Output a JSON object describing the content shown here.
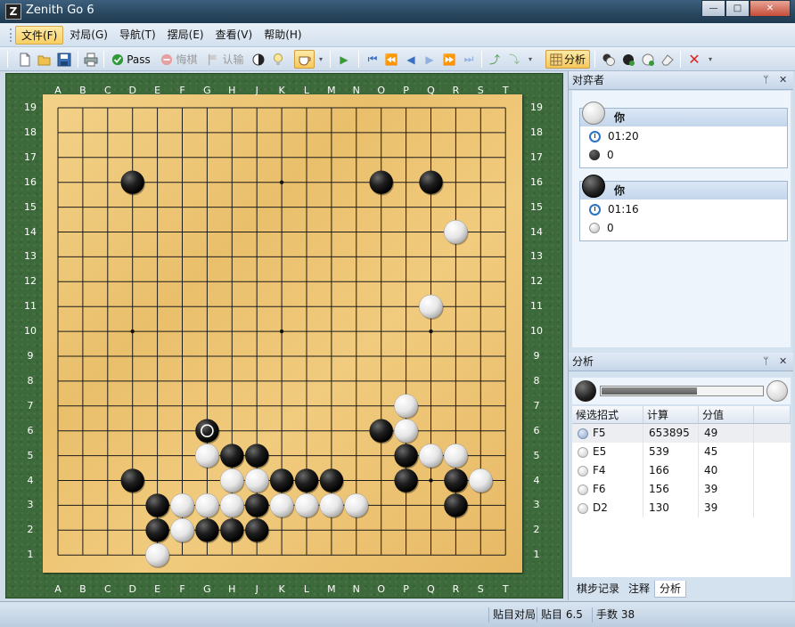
{
  "window": {
    "title": "Zenith Go 6",
    "min_label": "—",
    "max_label": "□",
    "close_label": "✕"
  },
  "menu": [
    {
      "label": "文件(F)",
      "active": true
    },
    {
      "label": "对局(G)"
    },
    {
      "label": "导航(T)"
    },
    {
      "label": "摆局(E)"
    },
    {
      "label": "查看(V)"
    },
    {
      "label": "帮助(H)"
    }
  ],
  "toolbar": {
    "pass_label": "Pass",
    "undo_label": "悔棋",
    "resign_label": "认输",
    "analysis_label": "分析"
  },
  "board": {
    "columns": [
      "A",
      "B",
      "C",
      "D",
      "E",
      "F",
      "G",
      "H",
      "J",
      "K",
      "L",
      "M",
      "N",
      "O",
      "P",
      "Q",
      "R",
      "S",
      "T"
    ],
    "rows": [
      "19",
      "18",
      "17",
      "16",
      "15",
      "14",
      "13",
      "12",
      "11",
      "10",
      "9",
      "8",
      "7",
      "6",
      "5",
      "4",
      "3",
      "2",
      "1"
    ],
    "star_points": [
      "D16",
      "K16",
      "Q16",
      "D10",
      "K10",
      "Q10",
      "D4",
      "K4",
      "Q4"
    ],
    "black_stones": [
      "D16",
      "O16",
      "Q16",
      "G6",
      "O6",
      "H5",
      "J5",
      "P5",
      "D4",
      "K4",
      "L4",
      "M4",
      "P4",
      "R4",
      "E3",
      "J3",
      "R3",
      "E2",
      "G2",
      "H2",
      "J2"
    ],
    "white_stones": [
      "R14",
      "Q11",
      "P7",
      "P6",
      "G5",
      "Q5",
      "R5",
      "H4",
      "J4",
      "S4",
      "F3",
      "G3",
      "H3",
      "K3",
      "L3",
      "M3",
      "N3",
      "F2",
      "E1"
    ],
    "last_move": "G6"
  },
  "players_panel": {
    "title": "对弈者",
    "pin_label": "ᛘ",
    "close_label": "✕",
    "white": {
      "name": "你",
      "time": "01:20",
      "captures": "0"
    },
    "black": {
      "name": "你",
      "time": "01:16",
      "captures": "0"
    }
  },
  "analysis_panel": {
    "title": "分析",
    "pin_label": "ᛘ",
    "close_label": "✕",
    "progress": 0.59,
    "headers": [
      "候选招式",
      "计算",
      "分值"
    ],
    "rows": [
      {
        "move": "F5",
        "count": "653895",
        "score": "49",
        "selected": true
      },
      {
        "move": "E5",
        "count": "539",
        "score": "45"
      },
      {
        "move": "F4",
        "count": "166",
        "score": "40"
      },
      {
        "move": "F6",
        "count": "156",
        "score": "39"
      },
      {
        "move": "D2",
        "count": "130",
        "score": "39"
      }
    ],
    "tabs": [
      {
        "label": "棋步记录"
      },
      {
        "label": "注释"
      },
      {
        "label": "分析",
        "active": true
      }
    ]
  },
  "status": {
    "mode": "贴目对局",
    "komi": "贴目 6.5",
    "moves": "手数 38"
  },
  "colors": {
    "board_light": "#f3d289",
    "board_dark": "#e6b864",
    "felt": "#3d6a3a",
    "accent": "#f8cf62"
  }
}
